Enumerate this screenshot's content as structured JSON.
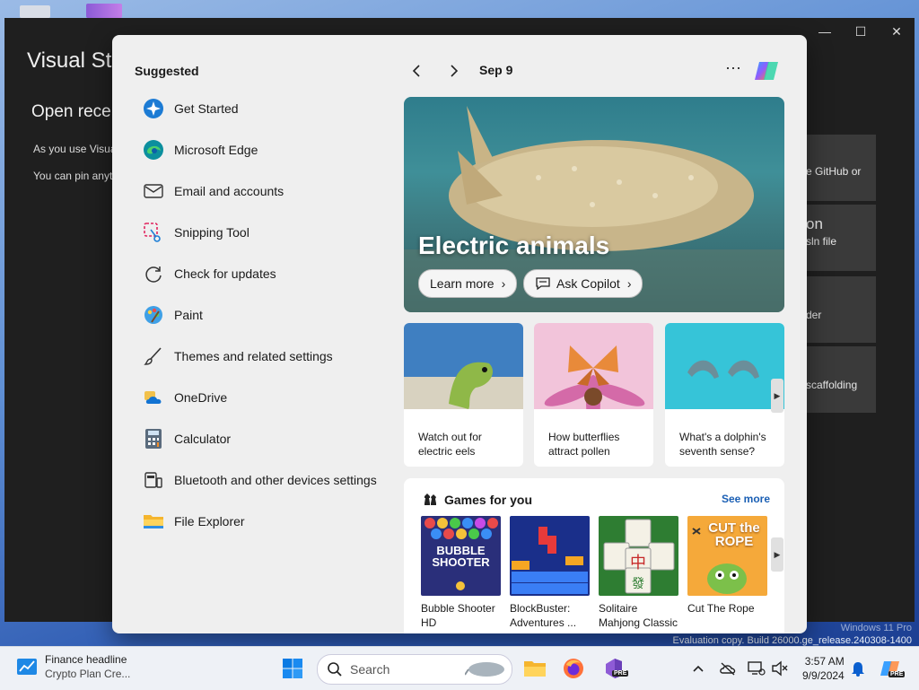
{
  "vs": {
    "title": "Visual Stu",
    "subtitle": "Open recen",
    "line1": "As you use Visua",
    "line2": "You can pin anyt",
    "card1": "e GitHub or",
    "card2_big": "on",
    "card2_small": "sln file",
    "card3": "der",
    "card4": "scaffolding",
    "status_line1": "Windows 11 Pro",
    "status_line2": "Evaluation copy. Build 26000.ge_release.240308-1400",
    "minimize": "—",
    "maximize": "☐",
    "close": "✕"
  },
  "start": {
    "suggested_heading": "Suggested",
    "apps": [
      {
        "label": "Get Started"
      },
      {
        "label": "Microsoft Edge"
      },
      {
        "label": "Email and accounts"
      },
      {
        "label": "Snipping Tool"
      },
      {
        "label": "Check for updates"
      },
      {
        "label": "Paint"
      },
      {
        "label": "Themes and related settings"
      },
      {
        "label": "OneDrive"
      },
      {
        "label": "Calculator"
      },
      {
        "label": "Bluetooth and other devices settings"
      },
      {
        "label": "File Explorer"
      }
    ]
  },
  "widgets": {
    "date": "Sep 9",
    "more": "···",
    "hero_title": "Electric animals",
    "learn_more": "Learn more",
    "ask_copilot": "Ask Copilot",
    "cards": [
      {
        "caption": "Watch out for electric eels"
      },
      {
        "caption": "How butterflies attract pollen"
      },
      {
        "caption": "What's a dolphin's seventh sense?"
      }
    ],
    "games_heading": "Games for you",
    "see_more": "See more",
    "games": [
      {
        "name": "Bubble Shooter HD",
        "thumb_text": "BUBBLE SHOOTER"
      },
      {
        "name": "BlockBuster: Adventures ..."
      },
      {
        "name": "Solitaire Mahjong Classic"
      },
      {
        "name": "Cut The Rope",
        "thumb_text": "CUT the ROPE"
      }
    ]
  },
  "taskbar": {
    "news_title": "Finance headline",
    "news_sub": "Crypto Plan Cre...",
    "search_placeholder": "Search",
    "time": "3:57 AM",
    "date": "9/9/2024",
    "pre_badge": "PRE"
  },
  "colors": {
    "accent": "#0067c0",
    "link": "#1a5fb4",
    "vs_bg": "#1f1f1f",
    "menu_bg": "#efefef"
  }
}
